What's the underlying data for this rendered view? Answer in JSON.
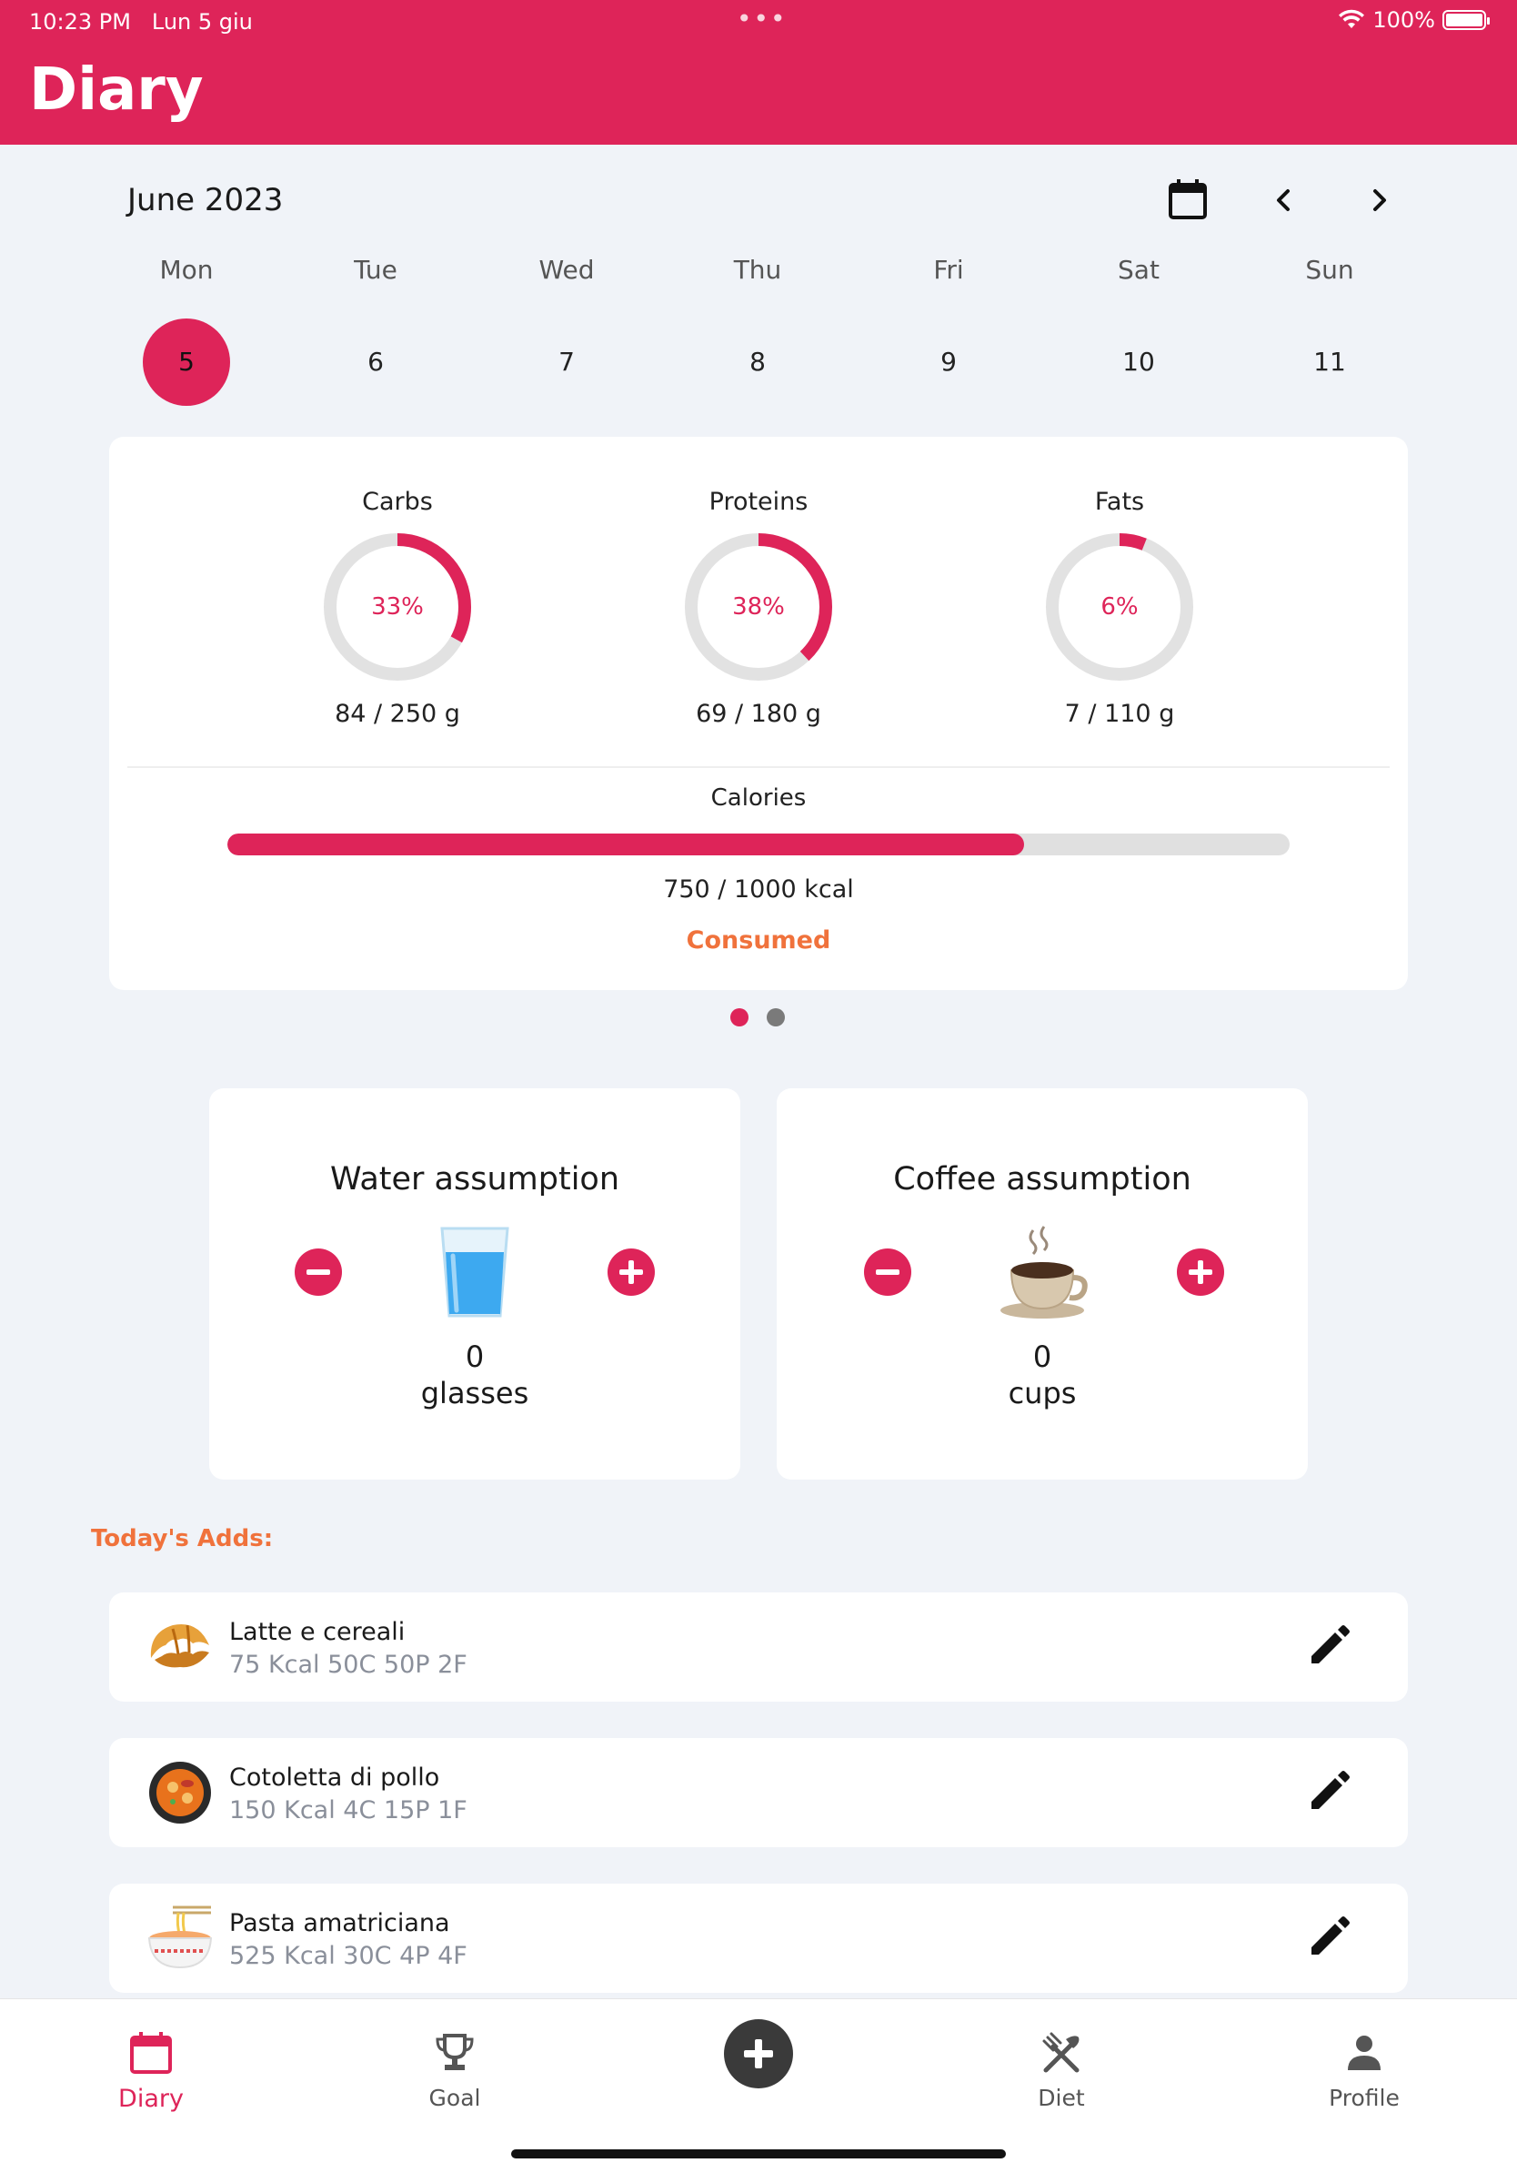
{
  "status_bar": {
    "time": "10:23 PM",
    "date": "Lun 5 giu",
    "battery": "100%"
  },
  "header": {
    "title": "Diary"
  },
  "calendar": {
    "month": "June 2023",
    "days": [
      {
        "name": "Mon",
        "num": "5",
        "selected": true
      },
      {
        "name": "Tue",
        "num": "6"
      },
      {
        "name": "Wed",
        "num": "7"
      },
      {
        "name": "Thu",
        "num": "8"
      },
      {
        "name": "Fri",
        "num": "9"
      },
      {
        "name": "Sat",
        "num": "10"
      },
      {
        "name": "Sun",
        "num": "11"
      }
    ]
  },
  "macros": [
    {
      "label": "Carbs",
      "percent": "33%",
      "fraction": 0.33,
      "amount": "84 / 250 g"
    },
    {
      "label": "Proteins",
      "percent": "38%",
      "fraction": 0.38,
      "amount": "69 / 180 g"
    },
    {
      "label": "Fats",
      "percent": "6%",
      "fraction": 0.06,
      "amount": "7 / 110 g"
    }
  ],
  "calories": {
    "label": "Calories",
    "amount": "750 / 1000 kcal",
    "fraction": 0.75,
    "status": "Consumed"
  },
  "water": {
    "title": "Water assumption",
    "count": "0",
    "unit": "glasses"
  },
  "coffee": {
    "title": "Coffee assumption",
    "count": "0",
    "unit": "cups"
  },
  "adds": {
    "title": "Today's Adds:",
    "items": [
      {
        "name": "Latte e cereali",
        "meta": "75 Kcal 50C 50P 2F",
        "icon": "croissant-icon"
      },
      {
        "name": "Cotoletta di pollo",
        "meta": "150 Kcal 4C 15P 1F",
        "icon": "paella-icon"
      },
      {
        "name": "Pasta amatriciana",
        "meta": "525 Kcal 30C 4P 4F",
        "icon": "noodle-bowl-icon"
      }
    ]
  },
  "tabs": [
    {
      "label": "Diary",
      "icon": "calendar-icon",
      "active": true
    },
    {
      "label": "Goal",
      "icon": "trophy-icon"
    },
    {
      "label": "Diet",
      "icon": "fork-knife-icon"
    },
    {
      "label": "Profile",
      "icon": "person-icon"
    }
  ],
  "colors": {
    "brand": "#DE2459",
    "accent_orange": "#F0723C",
    "background": "#F0F3F8"
  }
}
